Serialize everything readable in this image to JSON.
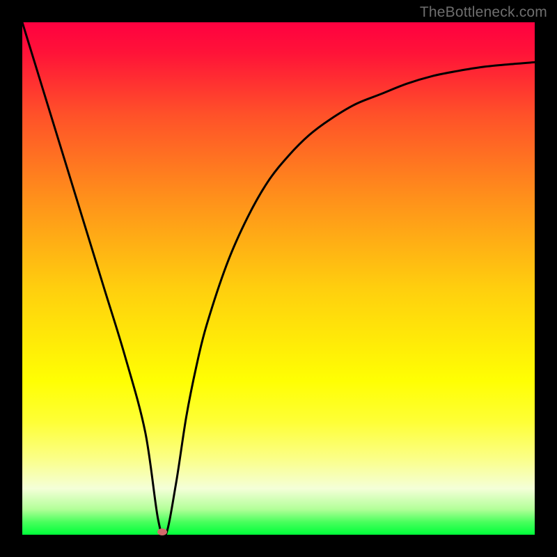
{
  "watermark": "TheBottleneck.com",
  "colors": {
    "frame": "#000000",
    "curve": "#000000",
    "marker": "#d16b6b",
    "gradient_top": "#ff0040",
    "gradient_bottom": "#00ff3a"
  },
  "chart_data": {
    "type": "line",
    "title": "",
    "xlabel": "",
    "ylabel": "",
    "xlim": [
      0,
      100
    ],
    "ylim": [
      0,
      100
    ],
    "x": [
      0,
      4,
      8,
      12,
      16,
      20,
      24,
      26.5,
      28,
      30,
      32,
      34,
      36,
      40,
      44,
      48,
      52,
      56,
      60,
      65,
      70,
      75,
      80,
      85,
      90,
      95,
      100
    ],
    "values": [
      100,
      87,
      74,
      61,
      48,
      35,
      20,
      3,
      0,
      10,
      23,
      33,
      41,
      53,
      62,
      69,
      74,
      78,
      81,
      84,
      86,
      88,
      89.5,
      90.5,
      91.3,
      91.8,
      92.2
    ],
    "marker": {
      "x": 27.3,
      "y": 0.5
    },
    "annotations": []
  }
}
